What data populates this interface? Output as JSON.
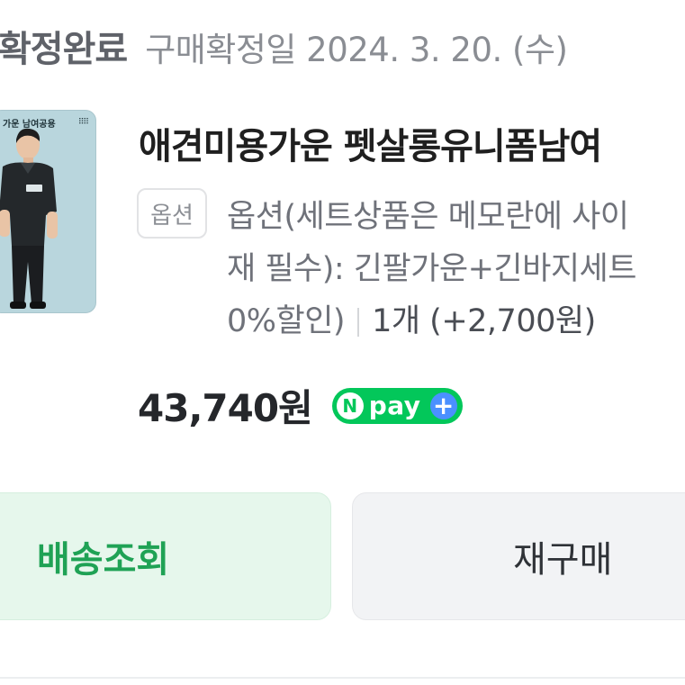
{
  "order": {
    "status_title": "확정완료",
    "status_date": "구매확정일 2024. 3. 20. (수)"
  },
  "product": {
    "thumbnail_caption": "가운 남여공용",
    "title": "애견미용가운 펫살롱유니폼남여",
    "option_badge": "옵션",
    "option_lines": [
      "옵션(세트상품은 메모란에 사이",
      "재 필수): 긴팔가운+긴바지세트",
      "0%할인)"
    ],
    "quantity": "1개 (+2,700원)",
    "price": "43,740원",
    "pay_badge": {
      "n_letter": "N",
      "label": "pay",
      "plus": "+",
      "color": "#03c75a"
    }
  },
  "actions": {
    "track_label": "배송조회",
    "rebuy_label": "재구매"
  },
  "colors": {
    "accent_green": "#1fa255",
    "track_bg": "#e6f7ec",
    "rebuy_bg": "#f2f3f5"
  }
}
